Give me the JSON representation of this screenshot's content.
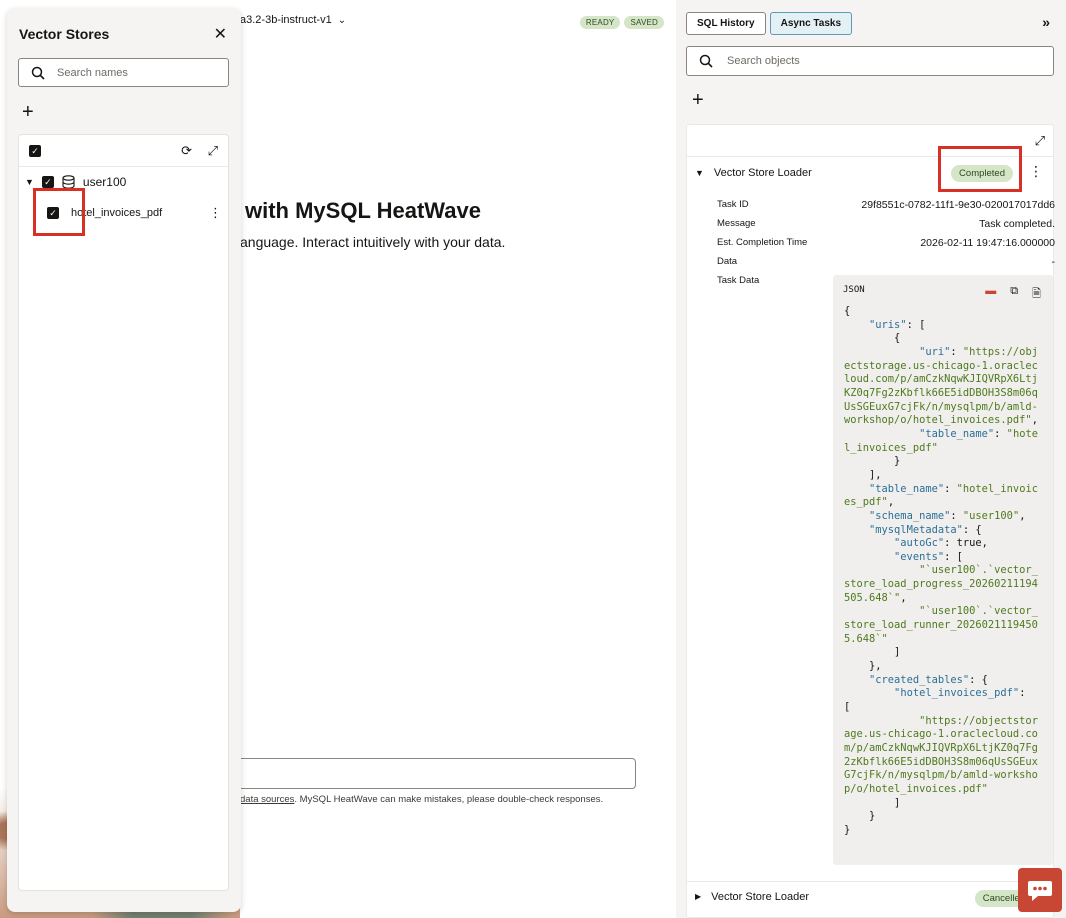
{
  "center": {
    "model": "a3.2-3b-instruct-v1",
    "status_ready": "READY",
    "status_saved": "SAVED",
    "hero_title": "with MySQL HeatWave",
    "hero_sub": "anguage. Interact intuitively with your data.",
    "disclaimer_link": "data sources",
    "disclaimer_rest": ". MySQL HeatWave can make mistakes, please double-check responses."
  },
  "left_panel": {
    "title": "Vector Stores",
    "search_placeholder": "Search names",
    "user": "user100",
    "file": "hotel_invoices_pdf"
  },
  "right_panel": {
    "tabs": [
      "SQL History",
      "Async Tasks"
    ],
    "active_tab": "Async Tasks",
    "search_placeholder": "Search objects",
    "task": {
      "title": "Vector Store Loader",
      "status": "Completed",
      "fields": {
        "task_id_label": "Task ID",
        "task_id": "29f8551c-0782-11f1-9e30-020017017dd6",
        "message_label": "Message",
        "message": "Task completed.",
        "est_label": "Est. Completion Time",
        "est": "2026-02-11 19:47:16.000000",
        "data_label": "Data",
        "data": "-",
        "task_data_label": "Task Data"
      },
      "code_format": "JSON",
      "json": {
        "uri": "https://objectstorage.us-chicago-1.oraclecloud.com/p/amCzkNqwKJIQVRpX6LtjKZ0q7Fg2zKbflk66E5idDBOH3S8m06qUsSGEuxG7cjFk/n/mysqlpm/b/amld-workshop/o/hotel_invoices.pdf",
        "table_name": "hotel_invoices_pdf",
        "schema_name": "user100",
        "auto_gc": "true",
        "event_1": "`user100`.`vector_store_load_progress_20260211194505.648`",
        "event_2": "`user100`.`vector_store_load_runner_20260211194505.648`",
        "created_key": "hotel_invoices_pdf",
        "created_uri": "https://objectstorage.us-chicago-1.oraclecloud.com/p/amCzkNqwKJIQVRpX6LtjKZ0q7Fg2zKbflk66E5idDBOH3S8m06qUsSGEuxG7cjFk/n/mysqlpm/b/amld-workshop/o/hotel_invoices.pdf"
      }
    },
    "task2": {
      "title": "Vector Store Loader",
      "status": "Cancelled"
    }
  }
}
